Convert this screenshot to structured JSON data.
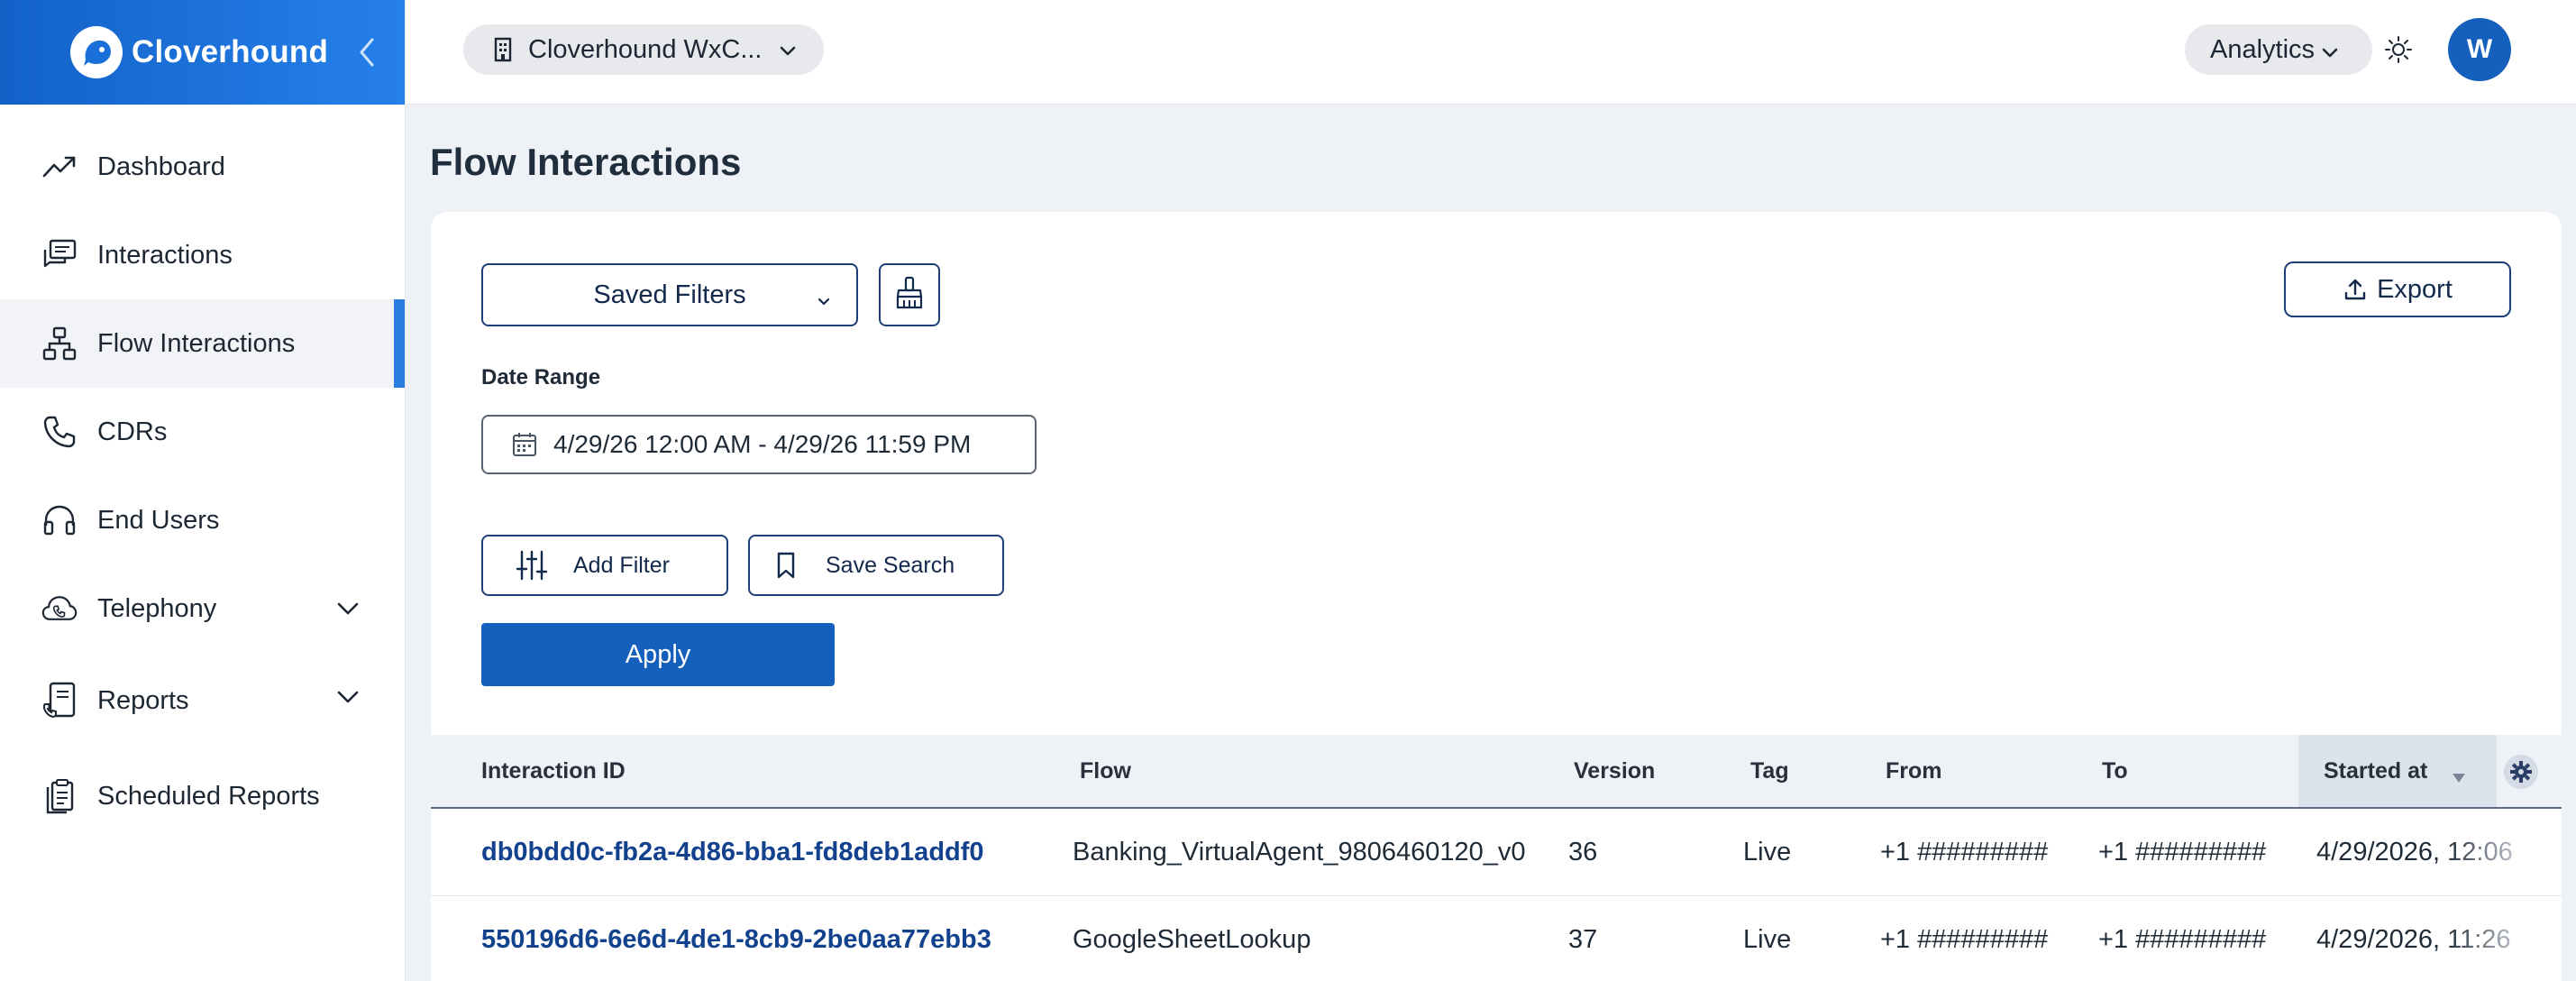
{
  "brand": {
    "name": "Cloverhound"
  },
  "sidebar": {
    "items": [
      {
        "label": "Dashboard",
        "icon": "trend-up-icon"
      },
      {
        "label": "Interactions",
        "icon": "chat-bubbles-icon"
      },
      {
        "label": "Flow Interactions",
        "icon": "flow-tree-icon",
        "active": true
      },
      {
        "label": "CDRs",
        "icon": "phone-icon"
      },
      {
        "label": "End Users",
        "icon": "headset-icon"
      },
      {
        "label": "Telephony",
        "icon": "cloud-phone-icon",
        "expandable": true
      },
      {
        "label": "Reports",
        "icon": "report-phone-icon",
        "expandable": true
      },
      {
        "label": "Scheduled Reports",
        "icon": "clipboard-icon"
      }
    ]
  },
  "topbar": {
    "org_name": "Cloverhound WxC...",
    "analytics_label": "Analytics",
    "avatar_initial": "W"
  },
  "main": {
    "title": "Flow Interactions",
    "saved_filters_label": "Saved Filters",
    "export_label": "Export",
    "date_range_label": "Date Range",
    "date_range_value": "4/29/26 12:00 AM - 4/29/26 11:59 PM",
    "add_filter_label": "Add Filter",
    "save_search_label": "Save Search",
    "apply_label": "Apply"
  },
  "table": {
    "columns": [
      "Interaction ID",
      "Flow",
      "Version",
      "Tag",
      "From",
      "To",
      "Started at"
    ],
    "sorted_column": "Started at",
    "rows": [
      [
        "db0bdd0c-fb2a-4d86-bba1-fd8deb1addf0",
        "Banking_VirtualAgent_9806460120_v0",
        "36",
        "Live",
        "+1 #########",
        "+1 #########",
        "4/29/2026, 12:06"
      ],
      [
        "550196d6-6e6d-4de1-8cb9-2be0aa77ebb3",
        "GoogleSheetLookup",
        "37",
        "Live",
        "+1 #########",
        "+1 #########",
        "4/29/2026, 11:26"
      ]
    ]
  },
  "colors": {
    "brand_blue": "#1560bd",
    "active_accent": "#2a7de1",
    "link_blue": "#12418d",
    "outline_navy": "#1d3f78"
  }
}
